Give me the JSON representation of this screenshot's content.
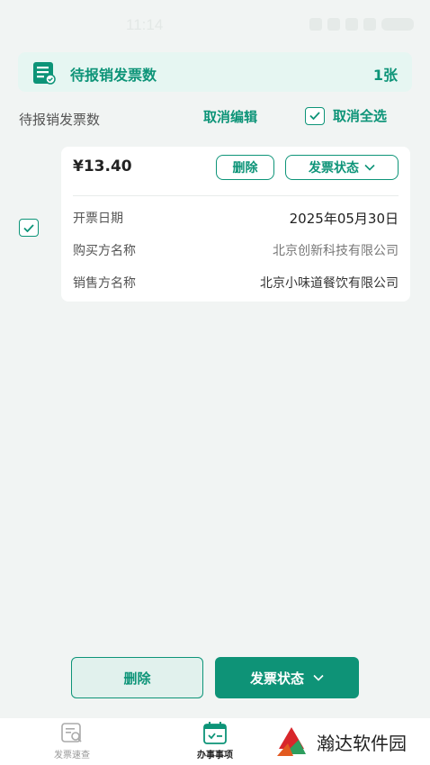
{
  "status_bar": {
    "time": "11:14"
  },
  "summary": {
    "title": "待报销发票数",
    "count": "1张"
  },
  "list_header": {
    "label": "待报销发票数",
    "cancel_edit": "取消编辑",
    "cancel_select_all": "取消全选"
  },
  "invoice": {
    "amount": "¥13.40",
    "delete_label": "删除",
    "status_label": "发票状态",
    "fields": [
      {
        "label": "开票日期",
        "value": "2025年05月30日"
      },
      {
        "label": "购买方名称",
        "value": "北京创新科技有限公司"
      },
      {
        "label": "销售方名称",
        "value": "北京小味道餐饮有限公司"
      }
    ]
  },
  "actions": {
    "delete_label": "删除",
    "status_label": "发票状态"
  },
  "tabs": [
    {
      "label": "发票速查",
      "active": false
    },
    {
      "label": "办事事项",
      "active": true
    }
  ],
  "watermark": {
    "text": "瀚达软件园"
  },
  "colors": {
    "accent": "#0d9478",
    "accent_button": "#0e9377",
    "banner_bg": "#e6f6f2",
    "page_bg": "#f1f4f3"
  }
}
